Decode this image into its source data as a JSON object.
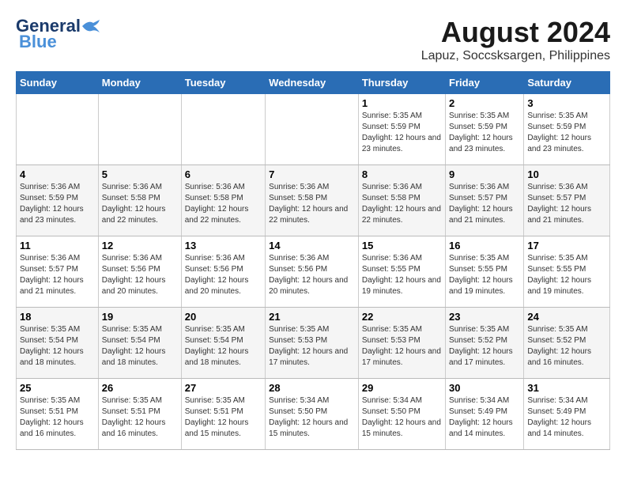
{
  "header": {
    "logo_line1": "General",
    "logo_line2": "Blue",
    "title": "August 2024",
    "subtitle": "Lapuz, Soccsksargen, Philippines"
  },
  "days_of_week": [
    "Sunday",
    "Monday",
    "Tuesday",
    "Wednesday",
    "Thursday",
    "Friday",
    "Saturday"
  ],
  "weeks": [
    [
      {
        "day": "",
        "sunrise": "",
        "sunset": "",
        "daylight": ""
      },
      {
        "day": "",
        "sunrise": "",
        "sunset": "",
        "daylight": ""
      },
      {
        "day": "",
        "sunrise": "",
        "sunset": "",
        "daylight": ""
      },
      {
        "day": "",
        "sunrise": "",
        "sunset": "",
        "daylight": ""
      },
      {
        "day": "1",
        "sunrise": "Sunrise: 5:35 AM",
        "sunset": "Sunset: 5:59 PM",
        "daylight": "Daylight: 12 hours and 23 minutes."
      },
      {
        "day": "2",
        "sunrise": "Sunrise: 5:35 AM",
        "sunset": "Sunset: 5:59 PM",
        "daylight": "Daylight: 12 hours and 23 minutes."
      },
      {
        "day": "3",
        "sunrise": "Sunrise: 5:35 AM",
        "sunset": "Sunset: 5:59 PM",
        "daylight": "Daylight: 12 hours and 23 minutes."
      }
    ],
    [
      {
        "day": "4",
        "sunrise": "Sunrise: 5:36 AM",
        "sunset": "Sunset: 5:59 PM",
        "daylight": "Daylight: 12 hours and 23 minutes."
      },
      {
        "day": "5",
        "sunrise": "Sunrise: 5:36 AM",
        "sunset": "Sunset: 5:58 PM",
        "daylight": "Daylight: 12 hours and 22 minutes."
      },
      {
        "day": "6",
        "sunrise": "Sunrise: 5:36 AM",
        "sunset": "Sunset: 5:58 PM",
        "daylight": "Daylight: 12 hours and 22 minutes."
      },
      {
        "day": "7",
        "sunrise": "Sunrise: 5:36 AM",
        "sunset": "Sunset: 5:58 PM",
        "daylight": "Daylight: 12 hours and 22 minutes."
      },
      {
        "day": "8",
        "sunrise": "Sunrise: 5:36 AM",
        "sunset": "Sunset: 5:58 PM",
        "daylight": "Daylight: 12 hours and 22 minutes."
      },
      {
        "day": "9",
        "sunrise": "Sunrise: 5:36 AM",
        "sunset": "Sunset: 5:57 PM",
        "daylight": "Daylight: 12 hours and 21 minutes."
      },
      {
        "day": "10",
        "sunrise": "Sunrise: 5:36 AM",
        "sunset": "Sunset: 5:57 PM",
        "daylight": "Daylight: 12 hours and 21 minutes."
      }
    ],
    [
      {
        "day": "11",
        "sunrise": "Sunrise: 5:36 AM",
        "sunset": "Sunset: 5:57 PM",
        "daylight": "Daylight: 12 hours and 21 minutes."
      },
      {
        "day": "12",
        "sunrise": "Sunrise: 5:36 AM",
        "sunset": "Sunset: 5:56 PM",
        "daylight": "Daylight: 12 hours and 20 minutes."
      },
      {
        "day": "13",
        "sunrise": "Sunrise: 5:36 AM",
        "sunset": "Sunset: 5:56 PM",
        "daylight": "Daylight: 12 hours and 20 minutes."
      },
      {
        "day": "14",
        "sunrise": "Sunrise: 5:36 AM",
        "sunset": "Sunset: 5:56 PM",
        "daylight": "Daylight: 12 hours and 20 minutes."
      },
      {
        "day": "15",
        "sunrise": "Sunrise: 5:36 AM",
        "sunset": "Sunset: 5:55 PM",
        "daylight": "Daylight: 12 hours and 19 minutes."
      },
      {
        "day": "16",
        "sunrise": "Sunrise: 5:35 AM",
        "sunset": "Sunset: 5:55 PM",
        "daylight": "Daylight: 12 hours and 19 minutes."
      },
      {
        "day": "17",
        "sunrise": "Sunrise: 5:35 AM",
        "sunset": "Sunset: 5:55 PM",
        "daylight": "Daylight: 12 hours and 19 minutes."
      }
    ],
    [
      {
        "day": "18",
        "sunrise": "Sunrise: 5:35 AM",
        "sunset": "Sunset: 5:54 PM",
        "daylight": "Daylight: 12 hours and 18 minutes."
      },
      {
        "day": "19",
        "sunrise": "Sunrise: 5:35 AM",
        "sunset": "Sunset: 5:54 PM",
        "daylight": "Daylight: 12 hours and 18 minutes."
      },
      {
        "day": "20",
        "sunrise": "Sunrise: 5:35 AM",
        "sunset": "Sunset: 5:54 PM",
        "daylight": "Daylight: 12 hours and 18 minutes."
      },
      {
        "day": "21",
        "sunrise": "Sunrise: 5:35 AM",
        "sunset": "Sunset: 5:53 PM",
        "daylight": "Daylight: 12 hours and 17 minutes."
      },
      {
        "day": "22",
        "sunrise": "Sunrise: 5:35 AM",
        "sunset": "Sunset: 5:53 PM",
        "daylight": "Daylight: 12 hours and 17 minutes."
      },
      {
        "day": "23",
        "sunrise": "Sunrise: 5:35 AM",
        "sunset": "Sunset: 5:52 PM",
        "daylight": "Daylight: 12 hours and 17 minutes."
      },
      {
        "day": "24",
        "sunrise": "Sunrise: 5:35 AM",
        "sunset": "Sunset: 5:52 PM",
        "daylight": "Daylight: 12 hours and 16 minutes."
      }
    ],
    [
      {
        "day": "25",
        "sunrise": "Sunrise: 5:35 AM",
        "sunset": "Sunset: 5:51 PM",
        "daylight": "Daylight: 12 hours and 16 minutes."
      },
      {
        "day": "26",
        "sunrise": "Sunrise: 5:35 AM",
        "sunset": "Sunset: 5:51 PM",
        "daylight": "Daylight: 12 hours and 16 minutes."
      },
      {
        "day": "27",
        "sunrise": "Sunrise: 5:35 AM",
        "sunset": "Sunset: 5:51 PM",
        "daylight": "Daylight: 12 hours and 15 minutes."
      },
      {
        "day": "28",
        "sunrise": "Sunrise: 5:34 AM",
        "sunset": "Sunset: 5:50 PM",
        "daylight": "Daylight: 12 hours and 15 minutes."
      },
      {
        "day": "29",
        "sunrise": "Sunrise: 5:34 AM",
        "sunset": "Sunset: 5:50 PM",
        "daylight": "Daylight: 12 hours and 15 minutes."
      },
      {
        "day": "30",
        "sunrise": "Sunrise: 5:34 AM",
        "sunset": "Sunset: 5:49 PM",
        "daylight": "Daylight: 12 hours and 14 minutes."
      },
      {
        "day": "31",
        "sunrise": "Sunrise: 5:34 AM",
        "sunset": "Sunset: 5:49 PM",
        "daylight": "Daylight: 12 hours and 14 minutes."
      }
    ]
  ]
}
